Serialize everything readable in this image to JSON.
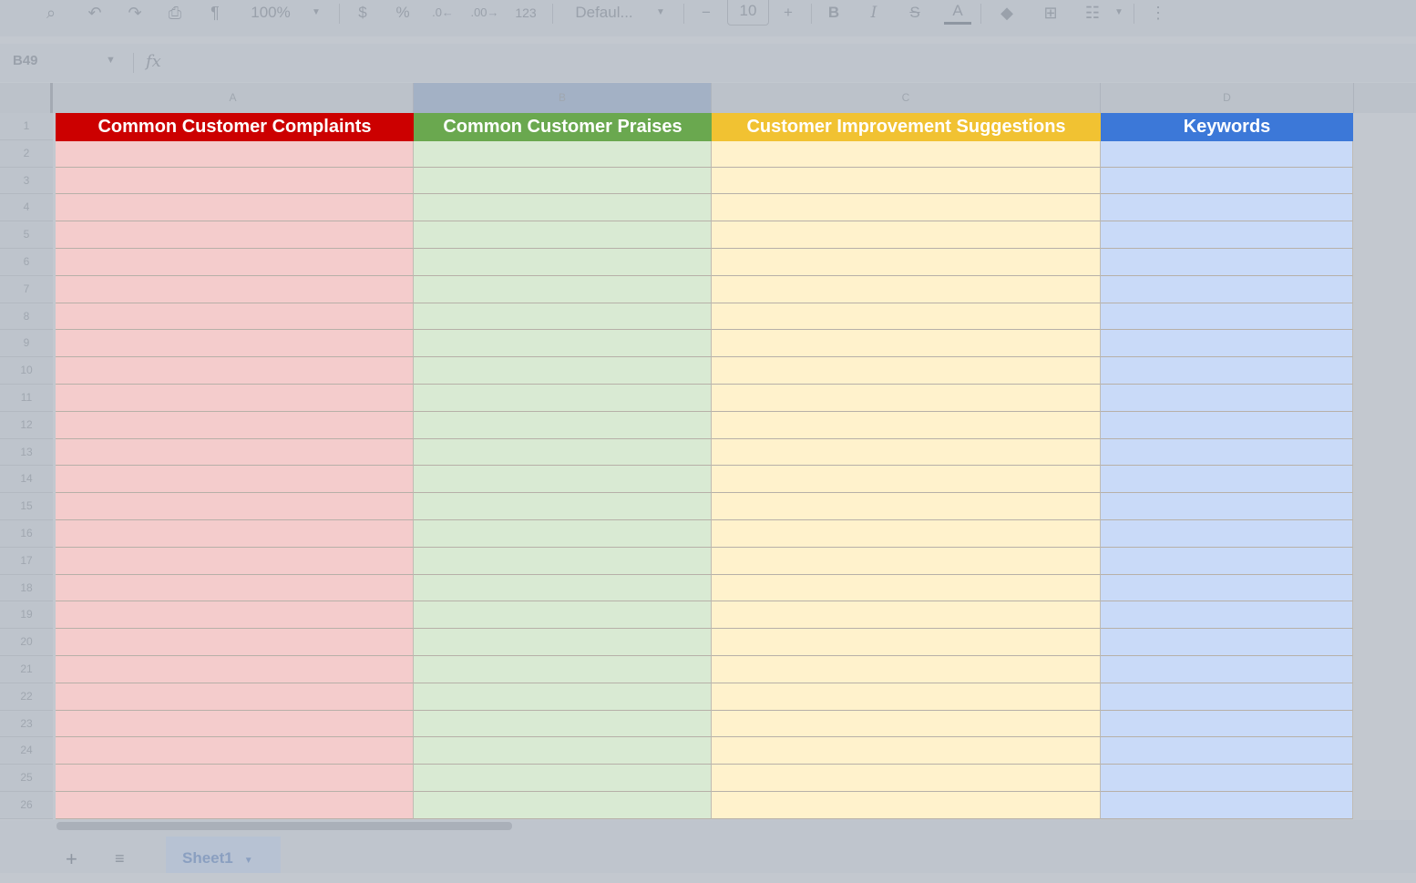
{
  "toolbar": {
    "zoom": "100%",
    "currency": "$",
    "percent": "%",
    "number_format": "123",
    "font": "Defaul...",
    "font_size": "10",
    "bold": "B",
    "italic": "I",
    "text_color_label": "A"
  },
  "formula_bar": {
    "name_box": "B49",
    "fx": "fx"
  },
  "columns": [
    "A",
    "B",
    "C",
    "D"
  ],
  "headers": [
    {
      "text": "Common Customer Complaints",
      "color": "#cc0000"
    },
    {
      "text": "Common Customer Praises",
      "color": "#6aa84f"
    },
    {
      "text": "Customer Improvement Suggestions",
      "color": "#f1c232"
    },
    {
      "text": "Keywords",
      "color": "#3c78d8"
    }
  ],
  "fills": [
    "#f4cccc",
    "#d9ead3",
    "#fff2cc",
    "#c9daf8"
  ],
  "rows": [
    "1",
    "2",
    "3",
    "4",
    "5",
    "6",
    "7",
    "8",
    "9",
    "10",
    "11",
    "12",
    "13",
    "14",
    "15",
    "16",
    "17",
    "18",
    "19",
    "20",
    "21",
    "22",
    "23",
    "24",
    "25",
    "26"
  ],
  "sheet": {
    "add": "+",
    "list": "≡",
    "tab_name": "Sheet1"
  },
  "icons": [
    "search-icon",
    "undo-icon",
    "redo-icon",
    "print-icon",
    "paint-format-icon",
    "borders-icon",
    "merge-icon",
    "more-icon"
  ]
}
